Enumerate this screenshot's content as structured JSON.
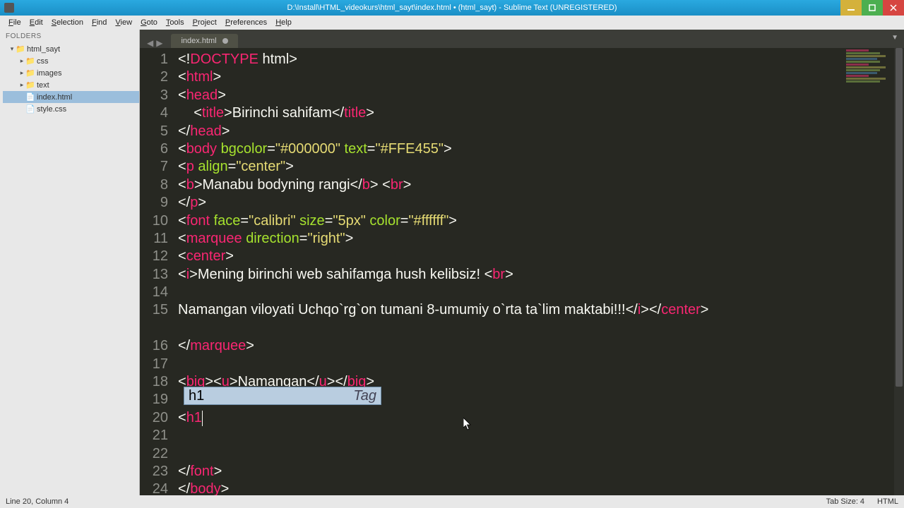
{
  "window": {
    "title": "D:\\Install\\HTML_videokurs\\html_sayt\\index.html • (html_sayt) - Sublime Text (UNREGISTERED)"
  },
  "menu": [
    "File",
    "Edit",
    "Selection",
    "Find",
    "View",
    "Goto",
    "Tools",
    "Project",
    "Preferences",
    "Help"
  ],
  "sidebar": {
    "header": "FOLDERS",
    "root": "html_sayt",
    "children": [
      {
        "kind": "folder",
        "name": "css"
      },
      {
        "kind": "folder",
        "name": "images"
      },
      {
        "kind": "folder",
        "name": "text"
      },
      {
        "kind": "file",
        "name": "index.html",
        "selected": true
      },
      {
        "kind": "file",
        "name": "style.css"
      }
    ]
  },
  "tabs": [
    {
      "label": "index.html",
      "dirty": true
    }
  ],
  "code": {
    "lines": [
      {
        "n": 1,
        "seg": [
          [
            "p-ang",
            "<!"
          ],
          [
            "p-doc",
            "DOCTYPE"
          ],
          [
            "p-txt",
            " html"
          ],
          [
            "p-ang",
            ">"
          ]
        ]
      },
      {
        "n": 2,
        "seg": [
          [
            "p-ang",
            "<"
          ],
          [
            "p-tag",
            "html"
          ],
          [
            "p-ang",
            ">"
          ]
        ]
      },
      {
        "n": 3,
        "seg": [
          [
            "p-ang",
            "<"
          ],
          [
            "p-tag",
            "head"
          ],
          [
            "p-ang",
            ">"
          ]
        ]
      },
      {
        "n": 4,
        "seg": [
          [
            "p-txt",
            "    "
          ],
          [
            "p-ang",
            "<"
          ],
          [
            "p-tag",
            "title"
          ],
          [
            "p-ang",
            ">"
          ],
          [
            "p-txt",
            "Birinchi sahifam"
          ],
          [
            "p-ang",
            "</"
          ],
          [
            "p-tag",
            "title"
          ],
          [
            "p-ang",
            ">"
          ]
        ]
      },
      {
        "n": 5,
        "seg": [
          [
            "p-ang",
            "</"
          ],
          [
            "p-tag",
            "head"
          ],
          [
            "p-ang",
            ">"
          ]
        ]
      },
      {
        "n": 6,
        "seg": [
          [
            "p-ang",
            "<"
          ],
          [
            "p-tag",
            "body"
          ],
          [
            "p-txt",
            " "
          ],
          [
            "p-attr",
            "bgcolor"
          ],
          [
            "p-ang",
            "="
          ],
          [
            "p-str",
            "\"#000000\""
          ],
          [
            "p-txt",
            " "
          ],
          [
            "p-attr",
            "text"
          ],
          [
            "p-ang",
            "="
          ],
          [
            "p-str",
            "\"#FFE455\""
          ],
          [
            "p-ang",
            ">"
          ]
        ]
      },
      {
        "n": 7,
        "seg": [
          [
            "p-ang",
            "<"
          ],
          [
            "p-tag",
            "p"
          ],
          [
            "p-txt",
            " "
          ],
          [
            "p-attr",
            "align"
          ],
          [
            "p-ang",
            "="
          ],
          [
            "p-str",
            "\"center\""
          ],
          [
            "p-ang",
            ">"
          ]
        ]
      },
      {
        "n": 8,
        "seg": [
          [
            "p-ang",
            "<"
          ],
          [
            "p-tag",
            "b"
          ],
          [
            "p-ang",
            ">"
          ],
          [
            "p-txt",
            "Manabu bodyning rangi"
          ],
          [
            "p-ang",
            "</"
          ],
          [
            "p-tag",
            "b"
          ],
          [
            "p-ang",
            ">"
          ],
          [
            "p-txt",
            " "
          ],
          [
            "p-ang",
            "<"
          ],
          [
            "p-tag",
            "br"
          ],
          [
            "p-ang",
            ">"
          ]
        ]
      },
      {
        "n": 9,
        "seg": [
          [
            "p-ang",
            "</"
          ],
          [
            "p-tag",
            "p"
          ],
          [
            "p-ang",
            ">"
          ]
        ]
      },
      {
        "n": 10,
        "seg": [
          [
            "p-ang",
            "<"
          ],
          [
            "p-tag",
            "font"
          ],
          [
            "p-txt",
            " "
          ],
          [
            "p-attr",
            "face"
          ],
          [
            "p-ang",
            "="
          ],
          [
            "p-str",
            "\"calibri\""
          ],
          [
            "p-txt",
            " "
          ],
          [
            "p-attr",
            "size"
          ],
          [
            "p-ang",
            "="
          ],
          [
            "p-str",
            "\"5px\""
          ],
          [
            "p-txt",
            " "
          ],
          [
            "p-attr",
            "color"
          ],
          [
            "p-ang",
            "="
          ],
          [
            "p-str",
            "\"#ffffff\""
          ],
          [
            "p-ang",
            ">"
          ]
        ]
      },
      {
        "n": 11,
        "seg": [
          [
            "p-ang",
            "<"
          ],
          [
            "p-tag",
            "marquee"
          ],
          [
            "p-txt",
            " "
          ],
          [
            "p-attr",
            "direction"
          ],
          [
            "p-ang",
            "="
          ],
          [
            "p-str",
            "\"right\""
          ],
          [
            "p-ang",
            ">"
          ]
        ]
      },
      {
        "n": 12,
        "seg": [
          [
            "p-ang",
            "<"
          ],
          [
            "p-tag",
            "center"
          ],
          [
            "p-ang",
            ">"
          ]
        ]
      },
      {
        "n": 13,
        "seg": [
          [
            "p-ang",
            "<"
          ],
          [
            "p-tag",
            "i"
          ],
          [
            "p-ang",
            ">"
          ],
          [
            "p-txt",
            "Mening birinchi web sahifamga hush kelibsiz! "
          ],
          [
            "p-ang",
            "<"
          ],
          [
            "p-tag",
            "br"
          ],
          [
            "p-ang",
            ">"
          ]
        ]
      },
      {
        "n": 14,
        "seg": []
      },
      {
        "n": 15,
        "seg": [
          [
            "p-txt",
            "Namangan viloyati Uchqo`rg`on tumani 8-umumiy o`rta ta`lim maktabi!!!"
          ],
          [
            "p-ang",
            "</"
          ],
          [
            "p-tag",
            "i"
          ],
          [
            "p-ang",
            "></"
          ],
          [
            "p-tag",
            "center"
          ],
          [
            "p-ang",
            ">"
          ]
        ],
        "wrap": true
      },
      {
        "n": 16,
        "seg": [
          [
            "p-ang",
            "</"
          ],
          [
            "p-tag",
            "marquee"
          ],
          [
            "p-ang",
            ">"
          ]
        ]
      },
      {
        "n": 17,
        "seg": []
      },
      {
        "n": 18,
        "seg": [
          [
            "p-ang",
            "<"
          ],
          [
            "p-tag",
            "big"
          ],
          [
            "p-ang",
            "><"
          ],
          [
            "p-tag",
            "u"
          ],
          [
            "p-ang",
            ">"
          ],
          [
            "p-txt",
            "Namangan"
          ],
          [
            "p-ang",
            "</"
          ],
          [
            "p-tag",
            "u"
          ],
          [
            "p-ang",
            "></"
          ],
          [
            "p-tag",
            "big"
          ],
          [
            "p-ang",
            ">"
          ]
        ]
      },
      {
        "n": 19,
        "seg": []
      },
      {
        "n": 20,
        "seg": [
          [
            "p-ang",
            "<"
          ],
          [
            "p-tag",
            "h1"
          ]
        ],
        "caret": true
      },
      {
        "n": 21,
        "seg": []
      },
      {
        "n": 22,
        "seg": []
      },
      {
        "n": 23,
        "seg": [
          [
            "p-ang",
            "</"
          ],
          [
            "p-tag",
            "font"
          ],
          [
            "p-ang",
            ">"
          ]
        ]
      },
      {
        "n": 24,
        "seg": [
          [
            "p-ang",
            "</"
          ],
          [
            "p-tag",
            "body"
          ],
          [
            "p-ang",
            ">"
          ]
        ]
      }
    ]
  },
  "autocomplete": {
    "left": "h1",
    "right": "Tag"
  },
  "status": {
    "left": "Line 20, Column 4",
    "tab": "Tab Size: 4",
    "lang": "HTML"
  }
}
